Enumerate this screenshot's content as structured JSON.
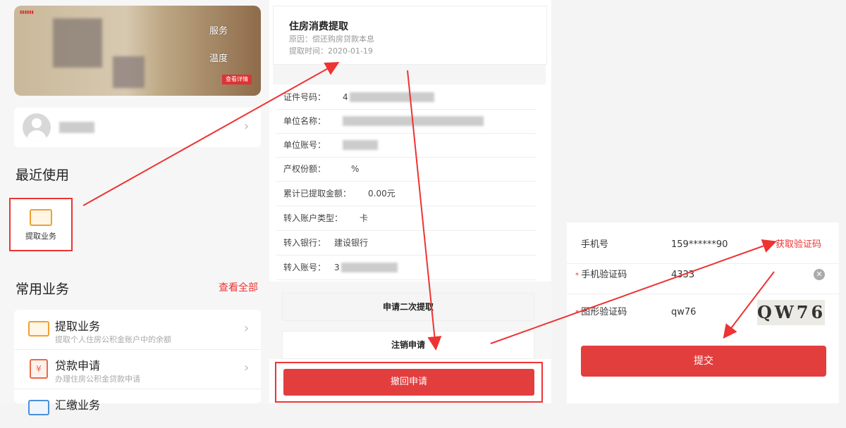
{
  "left": {
    "banner": {
      "title_lines": [
        "服务",
        "温度"
      ],
      "tag": "查看详情"
    },
    "recent": {
      "title": "最近使用",
      "item_label": "提取业务"
    },
    "common": {
      "title": "常用业务",
      "view_all": "查看全部",
      "services": [
        {
          "title": "提取业务",
          "subtitle": "提取个人住房公积金账户中的余额"
        },
        {
          "title": "贷款申请",
          "subtitle": "办理住房公积金贷款申请"
        },
        {
          "title": "汇缴业务",
          "subtitle": ""
        }
      ]
    }
  },
  "middle": {
    "header": {
      "title": "住房消费提取",
      "reason": "原因：偿还购房贷款本息",
      "date": "提取时间：2020-01-19"
    },
    "fields": [
      {
        "label": "证件号码：",
        "value": "4"
      },
      {
        "label": "单位名称：",
        "value": ""
      },
      {
        "label": "单位账号：",
        "value": ""
      },
      {
        "label": "产权份额：",
        "value": "%"
      },
      {
        "label": "累计已提取金额：",
        "value": "0.00元"
      },
      {
        "label": "转入账户类型：",
        "value": "卡"
      },
      {
        "label": "转入银行：",
        "value": "建设银行"
      },
      {
        "label": "转入账号：",
        "value": "3"
      }
    ],
    "buttons": {
      "second_withdraw": "申请二次提取",
      "cancel_application": "注销申请",
      "withdraw_application": "撤回申请"
    }
  },
  "right": {
    "phone_label": "手机号",
    "phone_value": "159******90",
    "get_code": "获取验证码",
    "sms_label": "手机验证码",
    "sms_value": "4333",
    "captcha_label": "图形验证码",
    "captcha_value": "qw76",
    "captcha_image_text": "QW76",
    "submit": "提交"
  },
  "colors": {
    "accent": "#e33e3e",
    "icon_orange": "#f0a030"
  }
}
